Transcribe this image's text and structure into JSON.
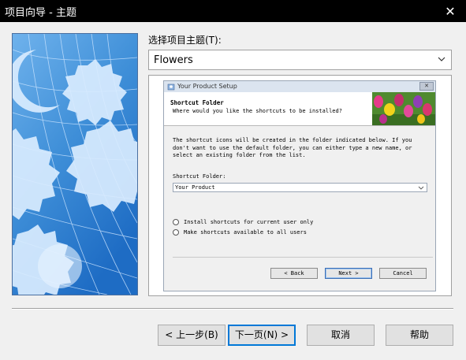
{
  "window": {
    "title": "项目向导 - 主题",
    "close_glyph": "✕"
  },
  "theme": {
    "label": "选择项目主题(T):",
    "selected": "Flowers"
  },
  "preview": {
    "dialog_title": "Your Product Setup",
    "close_glyph": "✕",
    "header_title": "Shortcut Folder",
    "header_subtitle": "Where would you like the shortcuts to be installed?",
    "description": [
      "The shortcut icons will be created in the folder indicated below. If you",
      "don't want to use the default folder, you can either type a new name, or",
      "select an existing folder from the list."
    ],
    "folder_label": "Shortcut Folder:",
    "folder_value": "Your Product",
    "radio_current_user": "Install shortcuts for current user only",
    "radio_all_users": "Make shortcuts available to all users",
    "back_label": "< Back",
    "next_label": "Next >",
    "cancel_label": "Cancel"
  },
  "buttons": {
    "back": "< 上一步(B)",
    "next": "下一页(N) >",
    "cancel": "取消",
    "help": "帮助"
  },
  "icons": {
    "close": "close-icon",
    "dropdown": "chevron-down-icon",
    "setup": "setup-icon"
  },
  "colors": {
    "titlebar": "#000000",
    "art_blue": "#3f8fd8",
    "default_button_border": "#0078d7"
  }
}
